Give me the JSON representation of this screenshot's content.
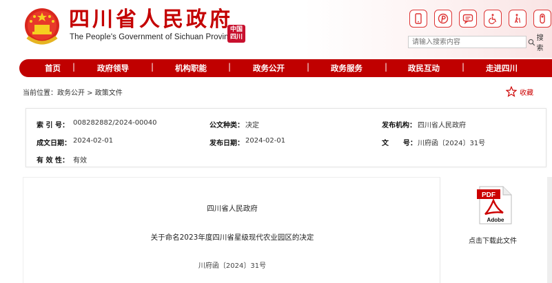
{
  "header": {
    "title": "四川省人民政府",
    "subtitle": "The People's Government of Sichuan Province",
    "seal_text": "中国四川",
    "icons": [
      "mobile-icon",
      "pinterest-icon",
      "chat-icon",
      "accessibility-icon",
      "elderly-icon",
      "toggle-icon"
    ],
    "search": {
      "placeholder": "请输入搜索内容",
      "button_label": "搜 索"
    }
  },
  "nav": {
    "items": [
      "首页",
      "政府领导",
      "机构职能",
      "政务公开",
      "政务服务",
      "政民互动",
      "走进四川"
    ]
  },
  "breadcrumb": {
    "label": "当前位置：政务公开 > 政策文件"
  },
  "favorite": {
    "label": "收藏"
  },
  "meta": {
    "index_label": "索 引 号：",
    "index_value": "008282882/2024-00040",
    "type_label": "公文种类：",
    "type_value": "决定",
    "agency_label": "发布机构：",
    "agency_value": "四川省人民政府",
    "created_label": "成文日期：",
    "created_value": "2024-02-01",
    "published_label": "发布日期：",
    "published_value": "2024-02-01",
    "docno_label": "文      号：",
    "docno_value": "川府函〔2024〕31号",
    "validity_label": "有 效 性：",
    "validity_value": "有效"
  },
  "document": {
    "issuer": "四川省人民政府",
    "title": "关于命名2023年度四川省星级现代农业园区的决定",
    "number": "川府函〔2024〕31号"
  },
  "attachment": {
    "pdf_label": "PDF",
    "adobe_label": "Adobe",
    "download_label": "点击下载此文件"
  },
  "colors": {
    "brand_red": "#c00000"
  }
}
